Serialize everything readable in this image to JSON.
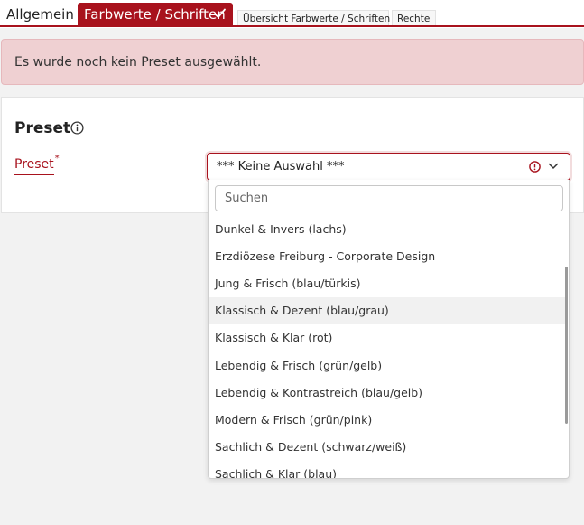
{
  "tabs": {
    "allgemein": "Allgemein",
    "farbwerte": "Farbwerte / Schriften",
    "uebersicht": "Übersicht Farbwerte / Schriften",
    "rechte": "Rechte"
  },
  "alert": {
    "text": "Es wurde noch kein Preset ausgewählt."
  },
  "section": {
    "title": "Preset"
  },
  "field": {
    "label": "Preset",
    "required_mark": "*",
    "value": "*** Keine Auswahl ***"
  },
  "dropdown": {
    "search_placeholder": "Suchen",
    "options": [
      "Dunkel & Invers (lachs)",
      "Erzdiözese Freiburg - Corporate Design",
      "Jung & Frisch (blau/türkis)",
      "Klassisch & Dezent (blau/grau)",
      "Klassisch & Klar (rot)",
      "Lebendig & Frisch (grün/gelb)",
      "Lebendig & Kontrastreich (blau/gelb)",
      "Modern & Frisch (grün/pink)",
      "Sachlich & Dezent (schwarz/weiß)",
      "Sachlich & Klar (blau)"
    ],
    "hovered_option": "Klassisch & Dezent (blau/grau)"
  },
  "colors": {
    "accent": "#a8121d",
    "alert_bg": "#efd0d2",
    "page_bg": "#f2f2f2"
  },
  "icons": [
    "check-icon",
    "info-icon",
    "warning-circle-icon",
    "chevron-down-icon"
  ]
}
